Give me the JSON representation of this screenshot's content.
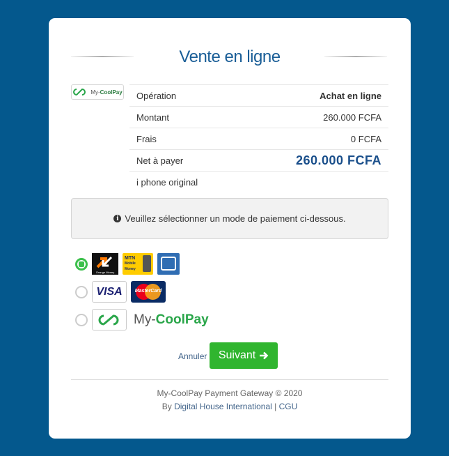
{
  "title": "Vente en ligne",
  "brand": {
    "small_prefix": "My-",
    "small_name": "CoolPay",
    "big_prefix": "My-",
    "big_name": "CoolPay"
  },
  "rows": [
    {
      "label": "Opération",
      "value": "Achat en ligne"
    },
    {
      "label": "Montant",
      "value": "260.000 FCFA"
    },
    {
      "label": "Frais",
      "value": "0 FCFA"
    },
    {
      "label": "Net à payer",
      "value": "260.000 FCFA"
    },
    {
      "label": "i phone original",
      "value": ""
    }
  ],
  "notice": "Veuillez sélectionner un mode de paiement ci-dessous.",
  "payment_methods": {
    "mobile_money": {
      "selected": true,
      "logos": [
        "orange-money",
        "mtn-mobile-money",
        "mobile-wallet"
      ],
      "om_label": "Orange Money",
      "mtn_label": "MTN Mobile Money"
    },
    "cards": {
      "selected": false,
      "visa": "VISA",
      "mastercard": "MasterCard"
    },
    "coolpay": {
      "selected": false
    }
  },
  "actions": {
    "cancel": "Annuler",
    "next": "Suivant"
  },
  "footer": {
    "line1": "My-CoolPay Payment Gateway © 2020",
    "by": "By",
    "company": "Digital House International",
    "sep": "|",
    "cgu": "CGU"
  },
  "colors": {
    "background": "#04588d",
    "accent": "#30b52f",
    "title": "#1a5e97",
    "net": "#1a4f8b"
  }
}
